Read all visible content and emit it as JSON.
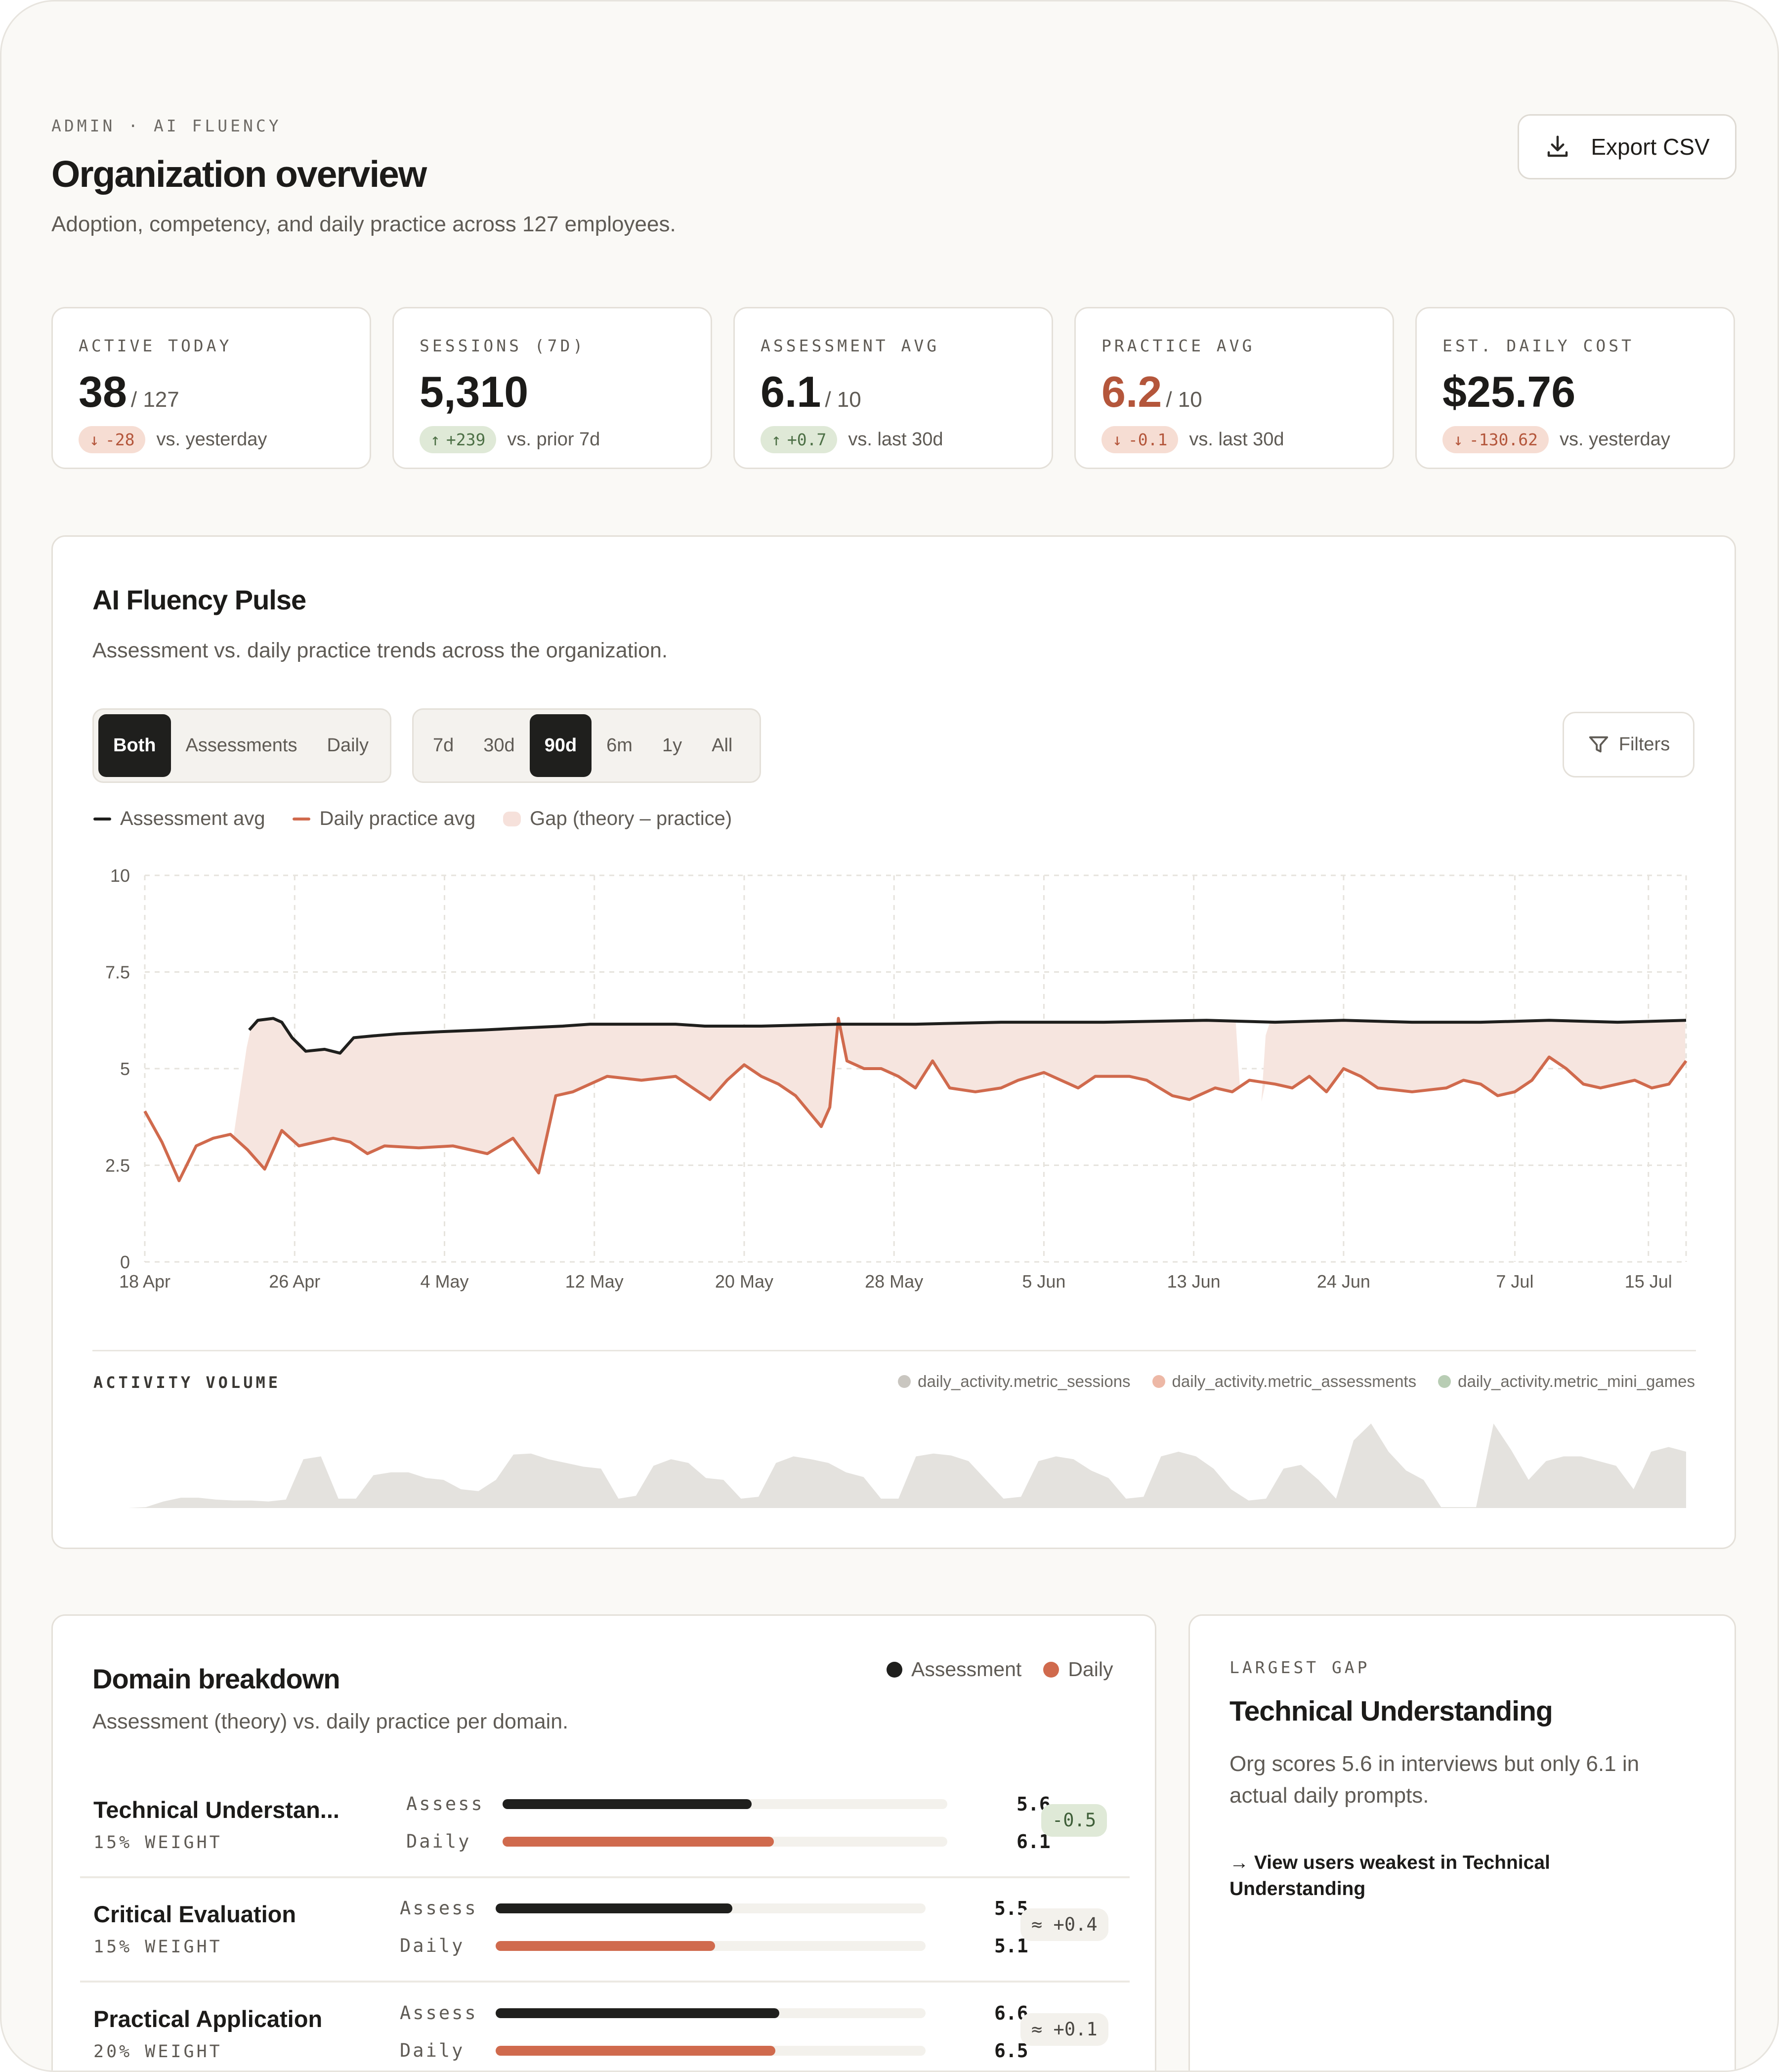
{
  "header": {
    "eyebrow": "ADMIN · AI FLUENCY",
    "title": "Organization overview",
    "subtitle": "Adoption, competency, and daily practice across 127 employees.",
    "export_label": "Export CSV",
    "export_icon": "download-icon"
  },
  "kpis": [
    {
      "label": "ACTIVE TODAY",
      "value": "38",
      "denom": "/ 127",
      "delta": "-28",
      "direction": "down",
      "compare": "vs. yesterday"
    },
    {
      "label": "SESSIONS (7D)",
      "value": "5,310",
      "denom": "",
      "delta": "+239",
      "direction": "up",
      "compare": "vs. prior 7d"
    },
    {
      "label": "ASSESSMENT AVG",
      "value": "6.1",
      "denom": "/ 10",
      "delta": "+0.7",
      "direction": "up",
      "compare": "vs. last 30d"
    },
    {
      "label": "PRACTICE AVG",
      "value": "6.2",
      "denom": "/ 10",
      "delta": "-0.1",
      "direction": "down",
      "compare": "vs. last 30d"
    },
    {
      "label": "EST. DAILY COST",
      "value": "$25.76",
      "denom": "",
      "delta": "-130.62",
      "direction": "down",
      "compare": "vs. yesterday"
    }
  ],
  "pulse": {
    "title": "AI Fluency Pulse",
    "subtitle": "Assessment vs. daily practice trends across the organization.",
    "series_toggle": [
      "Both",
      "Assessments",
      "Daily"
    ],
    "series_selected": "Both",
    "range_toggle": [
      "7d",
      "30d",
      "90d",
      "6m",
      "1y",
      "All"
    ],
    "range_selected": "90d",
    "filters_label": "Filters",
    "legend": {
      "assessment": "Assessment avg",
      "daily": "Daily practice avg",
      "gap": "Gap (theory – practice)"
    },
    "activity_title": "ACTIVITY VOLUME",
    "activity_legend": [
      "daily_activity.metric_sessions",
      "daily_activity.metric_assessments",
      "daily_activity.metric_mini_games"
    ]
  },
  "chart_data": {
    "type": "line",
    "ylim": [
      0,
      10
    ],
    "y_ticks": [
      "0",
      "2.5",
      "5",
      "7.5",
      "10"
    ],
    "x_ticks": [
      "18 Apr",
      "26 Apr",
      "4 May",
      "12 May",
      "20 May",
      "28 May",
      "5 Jun",
      "13 Jun",
      "24 Jun",
      "7 Jul",
      "15 Jul"
    ],
    "grid": true,
    "colors": {
      "assessment": "#1f1f1d",
      "daily": "#d06a4d",
      "gap": "#f6e5df",
      "activity": "#e4e2de"
    },
    "series": [
      {
        "name": "Assessment avg",
        "points": [
          [
            6.1,
            6.0
          ],
          [
            6.6,
            6.25
          ],
          [
            7.5,
            6.3
          ],
          [
            8.0,
            6.2
          ],
          [
            8.6,
            5.8
          ],
          [
            9.4,
            5.45
          ],
          [
            10.5,
            5.5
          ],
          [
            11.4,
            5.4
          ],
          [
            12.2,
            5.8
          ],
          [
            13.4,
            5.85
          ],
          [
            14.8,
            5.9
          ],
          [
            17.0,
            5.95
          ],
          [
            19.8,
            6.0
          ],
          [
            22.0,
            6.05
          ],
          [
            24.4,
            6.1
          ],
          [
            26.0,
            6.15
          ],
          [
            31.0,
            6.15
          ],
          [
            32.7,
            6.1
          ],
          [
            36.0,
            6.1
          ],
          [
            40.5,
            6.15
          ],
          [
            45.0,
            6.15
          ],
          [
            50.0,
            6.2
          ],
          [
            56.0,
            6.2
          ],
          [
            62.0,
            6.25
          ],
          [
            66.0,
            6.2
          ],
          [
            70.0,
            6.25
          ],
          [
            74.0,
            6.2
          ],
          [
            78.0,
            6.2
          ],
          [
            82.0,
            6.25
          ],
          [
            86.0,
            6.2
          ],
          [
            90.0,
            6.25
          ]
        ]
      },
      {
        "name": "Daily practice avg",
        "points": [
          [
            0.0,
            3.9
          ],
          [
            1.0,
            3.1
          ],
          [
            2.0,
            2.1
          ],
          [
            3.0,
            3.0
          ],
          [
            4.0,
            3.2
          ],
          [
            5.0,
            3.3
          ],
          [
            6.0,
            2.9
          ],
          [
            7.0,
            2.4
          ],
          [
            8.0,
            3.4
          ],
          [
            9.0,
            3.0
          ],
          [
            10.0,
            3.1
          ],
          [
            11.0,
            3.2
          ],
          [
            12.0,
            3.1
          ],
          [
            13.0,
            2.8
          ],
          [
            14.0,
            3.0
          ],
          [
            16.0,
            2.95
          ],
          [
            18.0,
            3.0
          ],
          [
            20.0,
            2.8
          ],
          [
            21.5,
            3.2
          ],
          [
            22.5,
            2.6
          ],
          [
            23.0,
            2.3
          ],
          [
            24.0,
            4.3
          ],
          [
            25.0,
            4.4
          ],
          [
            27.0,
            4.8
          ],
          [
            29.0,
            4.7
          ],
          [
            31.0,
            4.8
          ],
          [
            32.0,
            4.5
          ],
          [
            33.0,
            4.2
          ],
          [
            34.0,
            4.7
          ],
          [
            35.0,
            5.1
          ],
          [
            36.0,
            4.8
          ],
          [
            37.0,
            4.6
          ],
          [
            38.0,
            4.3
          ],
          [
            39.5,
            3.5
          ],
          [
            40.0,
            4.0
          ],
          [
            40.5,
            6.3
          ],
          [
            41.0,
            5.2
          ],
          [
            42.0,
            5.0
          ],
          [
            43.0,
            5.0
          ],
          [
            44.0,
            4.8
          ],
          [
            45.0,
            4.5
          ],
          [
            46.0,
            5.2
          ],
          [
            47.0,
            4.5
          ],
          [
            48.5,
            4.4
          ],
          [
            50.0,
            4.5
          ],
          [
            51.0,
            4.7
          ],
          [
            52.5,
            4.9
          ],
          [
            53.5,
            4.7
          ],
          [
            54.5,
            4.5
          ],
          [
            55.5,
            4.8
          ],
          [
            57.5,
            4.8
          ],
          [
            58.5,
            4.7
          ],
          [
            60.0,
            4.3
          ],
          [
            61.0,
            4.2
          ],
          [
            62.5,
            4.5
          ],
          [
            63.5,
            4.4
          ],
          [
            64.5,
            4.7
          ],
          [
            66.0,
            4.6
          ],
          [
            67.0,
            4.5
          ],
          [
            68.0,
            4.8
          ],
          [
            69.0,
            4.4
          ],
          [
            70.0,
            5.0
          ],
          [
            71.0,
            4.8
          ],
          [
            72.0,
            4.5
          ],
          [
            74.0,
            4.4
          ],
          [
            76.0,
            4.5
          ],
          [
            77.0,
            4.7
          ],
          [
            78.0,
            4.6
          ],
          [
            79.0,
            4.3
          ],
          [
            80.0,
            4.4
          ],
          [
            81.0,
            4.7
          ],
          [
            82.0,
            5.3
          ],
          [
            83.0,
            5.0
          ],
          [
            84.0,
            4.6
          ],
          [
            85.0,
            4.5
          ],
          [
            86.0,
            4.6
          ],
          [
            87.0,
            4.7
          ],
          [
            88.0,
            4.5
          ],
          [
            89.0,
            4.6
          ],
          [
            90.0,
            5.2
          ]
        ]
      }
    ],
    "activity_volume": [
      0,
      0,
      0,
      0.01,
      0.07,
      0.11,
      0.11,
      0.09,
      0.08,
      0.08,
      0.07,
      0.09,
      0.52,
      0.55,
      0.1,
      0.1,
      0.35,
      0.38,
      0.38,
      0.32,
      0.3,
      0.2,
      0.18,
      0.3,
      0.57,
      0.58,
      0.52,
      0.48,
      0.44,
      0.42,
      0.1,
      0.13,
      0.45,
      0.52,
      0.48,
      0.32,
      0.3,
      0.1,
      0.12,
      0.48,
      0.55,
      0.52,
      0.48,
      0.38,
      0.33,
      0.1,
      0.1,
      0.55,
      0.58,
      0.56,
      0.5,
      0.3,
      0.1,
      0.12,
      0.5,
      0.55,
      0.52,
      0.4,
      0.32,
      0.1,
      0.12,
      0.55,
      0.6,
      0.55,
      0.42,
      0.2,
      0.08,
      0.1,
      0.42,
      0.46,
      0.3,
      0.1,
      0.72,
      0.9,
      0.6,
      0.4,
      0.3,
      0.01,
      0.01,
      0.01,
      0.9,
      0.62,
      0.3,
      0.5,
      0.55,
      0.55,
      0.5,
      0.45,
      0.2,
      0.6,
      0.65,
      0.6
    ]
  },
  "domain": {
    "title": "Domain breakdown",
    "subtitle": "Assessment (theory) vs. daily practice per domain.",
    "legend": [
      "Assessment",
      "Daily"
    ],
    "assess_label": "Assess",
    "daily_label": "Daily",
    "rows": [
      {
        "name": "Technical Understan...",
        "weight": "15% WEIGHT",
        "assess": 5.6,
        "assess_text": "5.6",
        "daily": 6.1,
        "daily_text": "6.1",
        "delta": "-0.5",
        "tone": "good"
      },
      {
        "name": "Critical Evaluation",
        "weight": "15% WEIGHT",
        "assess": 5.5,
        "assess_text": "5.5",
        "daily": 5.1,
        "daily_text": "5.1",
        "delta": "≈ +0.4",
        "tone": "neutral"
      },
      {
        "name": "Practical Application",
        "weight": "20% WEIGHT",
        "assess": 6.6,
        "assess_text": "6.6",
        "daily": 6.5,
        "daily_text": "6.5",
        "delta": "≈ +0.1",
        "tone": "neutral"
      }
    ]
  },
  "largest_gap": {
    "eyebrow": "LARGEST GAP",
    "title": "Technical Understanding",
    "body": "Org scores 5.6 in interviews but only 6.1 in actual daily prompts.",
    "link": "→ View users weakest in Technical Understanding"
  }
}
